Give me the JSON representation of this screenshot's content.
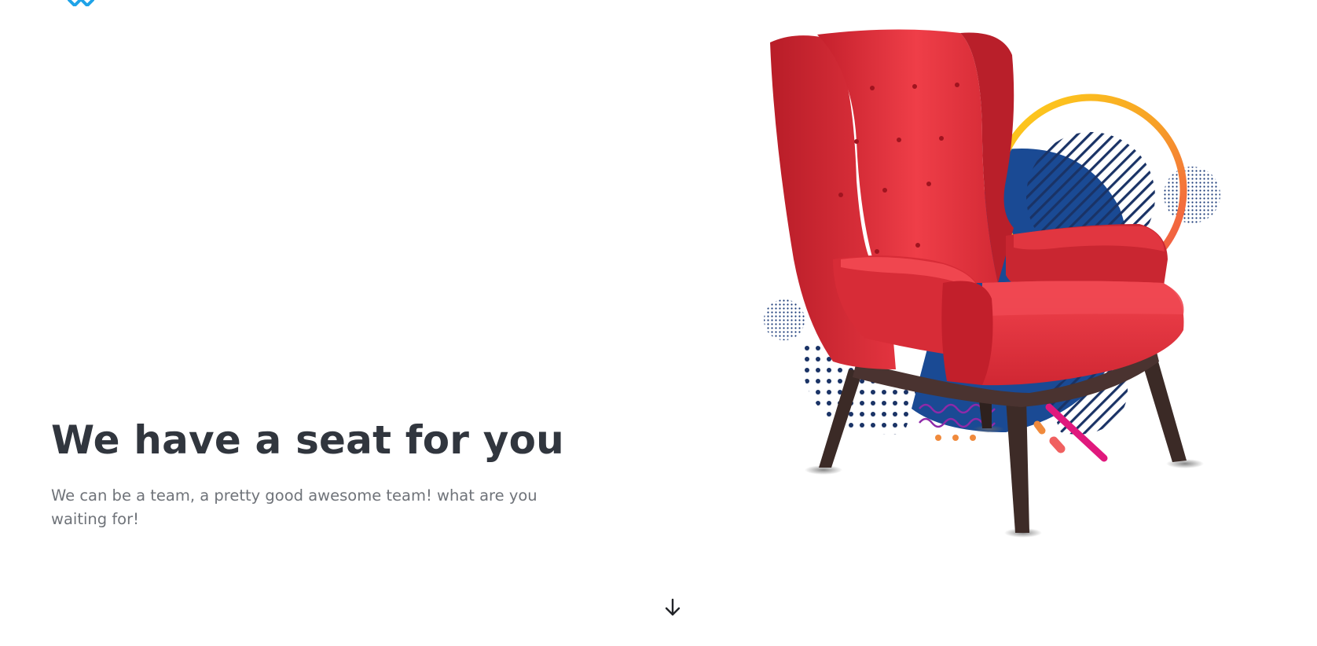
{
  "hero": {
    "title": "We have a seat for you",
    "subtitle": "We can be a team, a pretty good awesome team! what are you waiting for!"
  },
  "icons": {
    "logo": "logo-mark",
    "scroll": "arrow-down-icon",
    "hero_image": "red-armchair-illustration"
  },
  "colors": {
    "title": "#31363e",
    "subtitle": "#6f7379",
    "chair_red": "#e4323e",
    "chair_legs": "#3b2a26",
    "navy": "#1a4a94",
    "ring_yellow": "#f9c21a",
    "ring_orange": "#f26a3f",
    "accent_pink": "#e0197d",
    "accent_orange": "#f08a3c",
    "wave_purple": "#8e2aa8",
    "logo_blue": "#1fa3e8"
  }
}
